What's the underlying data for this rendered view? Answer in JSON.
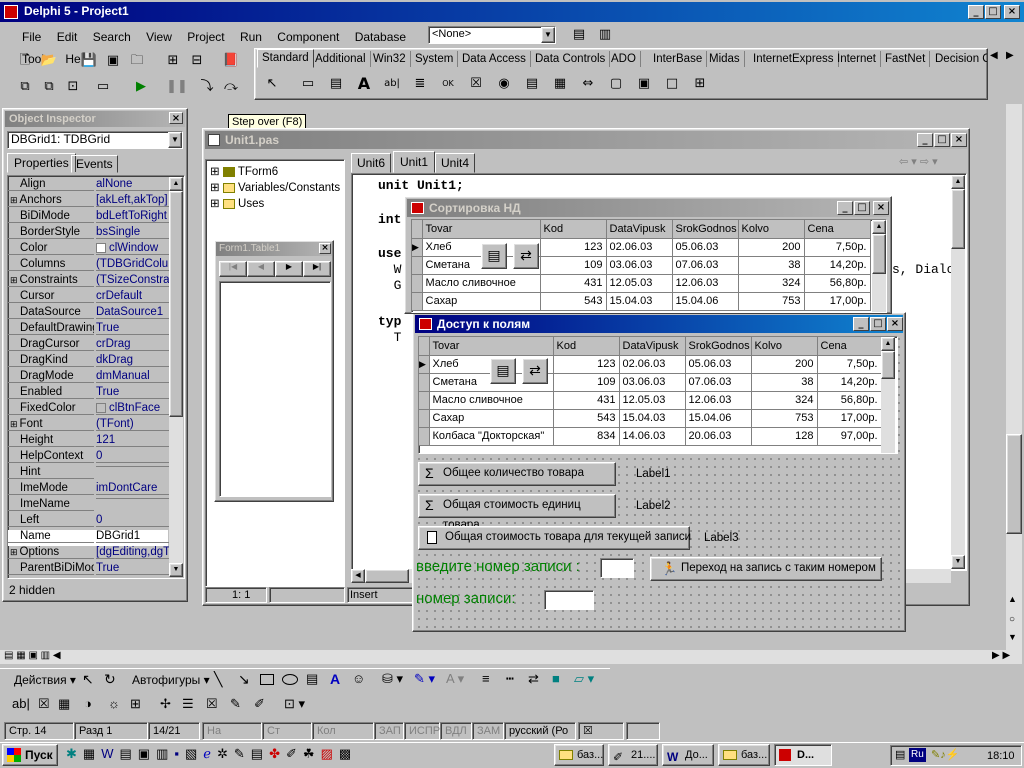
{
  "ide": {
    "title": "Delphi 5 - Project1",
    "menu": [
      "File",
      "Edit",
      "Search",
      "View",
      "Project",
      "Run",
      "Component",
      "Database",
      "Tools",
      "Help"
    ],
    "config_combo": "<None>",
    "palette_tabs": [
      "Standard",
      "Additional",
      "Win32",
      "System",
      "Data Access",
      "Data Controls",
      "ADO",
      "InterBase",
      "Midas",
      "InternetExpress",
      "Internet",
      "FastNet",
      "Decision C"
    ],
    "tooltip": "Step over (F8)"
  },
  "inspector": {
    "title": "Object Inspector",
    "object_combo": "DBGrid1: TDBGrid",
    "tabs": [
      "Properties",
      "Events"
    ],
    "rows": [
      {
        "name": "Align",
        "value": "alNone",
        "plus": false
      },
      {
        "name": "Anchors",
        "value": "[akLeft,akTop]",
        "plus": true
      },
      {
        "name": "BiDiMode",
        "value": "bdLeftToRight",
        "plus": false
      },
      {
        "name": "BorderStyle",
        "value": "bsSingle",
        "plus": false
      },
      {
        "name": "Color",
        "value": "clWindow",
        "plus": false
      },
      {
        "name": "Columns",
        "value": "(TDBGridColum",
        "plus": false
      },
      {
        "name": "Constraints",
        "value": "(TSizeConstrain",
        "plus": true
      },
      {
        "name": "Cursor",
        "value": "crDefault",
        "plus": false
      },
      {
        "name": "DataSource",
        "value": "DataSource1",
        "plus": false
      },
      {
        "name": "DefaultDrawing",
        "value": "True",
        "plus": false
      },
      {
        "name": "DragCursor",
        "value": "crDrag",
        "plus": false
      },
      {
        "name": "DragKind",
        "value": "dkDrag",
        "plus": false
      },
      {
        "name": "DragMode",
        "value": "dmManual",
        "plus": false
      },
      {
        "name": "Enabled",
        "value": "True",
        "plus": false
      },
      {
        "name": "FixedColor",
        "value": "clBtnFace",
        "plus": false
      },
      {
        "name": "Font",
        "value": "(TFont)",
        "plus": true
      },
      {
        "name": "Height",
        "value": "121",
        "plus": false
      },
      {
        "name": "HelpContext",
        "value": "0",
        "plus": false
      },
      {
        "name": "Hint",
        "value": "",
        "plus": false
      },
      {
        "name": "ImeMode",
        "value": "imDontCare",
        "plus": false
      },
      {
        "name": "ImeName",
        "value": "",
        "plus": false
      },
      {
        "name": "Left",
        "value": "0",
        "plus": false
      },
      {
        "name": "Name",
        "value": "DBGrid1",
        "plus": false
      },
      {
        "name": "Options",
        "value": "[dgEditing,dgTit",
        "plus": true
      },
      {
        "name": "ParentBiDiMod",
        "value": "True",
        "plus": false
      }
    ],
    "footer": "2 hidden"
  },
  "editor": {
    "title": "Unit1.pas",
    "tabs": [
      "Unit6",
      "Unit1",
      "Unit4"
    ],
    "tree": [
      "TForm6",
      "Variables/Constants",
      "Uses"
    ],
    "small_form_title": "Form1.Table1",
    "code_lines": [
      "unit Unit1;",
      "int",
      "use",
      "  W",
      "  G",
      "typ",
      "  T"
    ],
    "code_tail": "s, Dialo",
    "status_pos": "1:  1",
    "status_mode": "Insert"
  },
  "sort_form": {
    "title": "Сортировка НД",
    "columns": [
      "Tovar",
      "Kod",
      "DataVipusk",
      "SrokGodnos",
      "Kolvo",
      "Cena"
    ],
    "rows": [
      [
        "Хлеб",
        "123",
        "02.06.03",
        "05.06.03",
        "200",
        "7,50р."
      ],
      [
        "Сметана",
        "109",
        "03.06.03",
        "07.06.03",
        "38",
        "14,20р."
      ],
      [
        "Масло сливочное",
        "431",
        "12.05.03",
        "12.06.03",
        "324",
        "56,80р."
      ],
      [
        "Сахар",
        "543",
        "15.04.03",
        "15.04.06",
        "753",
        "17,00р."
      ]
    ]
  },
  "access_form": {
    "title": "Доступ к полям",
    "columns": [
      "Tovar",
      "Kod",
      "DataVipusk",
      "SrokGodnos",
      "Kolvo",
      "Cena"
    ],
    "rows": [
      [
        "Хлеб",
        "123",
        "02.06.03",
        "05.06.03",
        "200",
        "7,50р."
      ],
      [
        "Сметана",
        "109",
        "03.06.03",
        "07.06.03",
        "38",
        "14,20р."
      ],
      [
        "Масло сливочное",
        "431",
        "12.05.03",
        "12.06.03",
        "324",
        "56,80р."
      ],
      [
        "Сахар",
        "543",
        "15.04.03",
        "15.04.06",
        "753",
        "17,00р."
      ],
      [
        "Колбаса \"Докторская\"",
        "834",
        "14.06.03",
        "20.06.03",
        "128",
        "97,00р."
      ]
    ],
    "btn_total_qty": "Общее количество товара",
    "label1": "Label1",
    "btn_total_cost": "Общая стоимость единиц товара",
    "label2": "Label2",
    "btn_record_cost": "Общая стоимость товара для текущей записи",
    "label3": "Label3",
    "enter_record_label": "введите номер записи :",
    "btn_goto": "Переход на запись с таким номером",
    "record_no_label": "номер записи:",
    "green": "#008000"
  },
  "word": {
    "draw_actions": "Действия",
    "autoshapes": "Автофигуры",
    "status": [
      "Стр. 14",
      "Разд 1",
      "14/21",
      "На",
      "Ст",
      "Кол",
      "ЗАП",
      "ИСПР",
      "ВДЛ",
      "ЗАМ",
      "русский (Ро"
    ]
  },
  "taskbar": {
    "start": "Пуск",
    "tasks": [
      "баз...",
      "21....",
      "До...",
      "баз...",
      "D..."
    ],
    "lang": "Ru",
    "clock": "18:10"
  },
  "colors": {
    "active_title": "#000080",
    "inactive_title": "#808080",
    "prop_value": "#000080"
  }
}
